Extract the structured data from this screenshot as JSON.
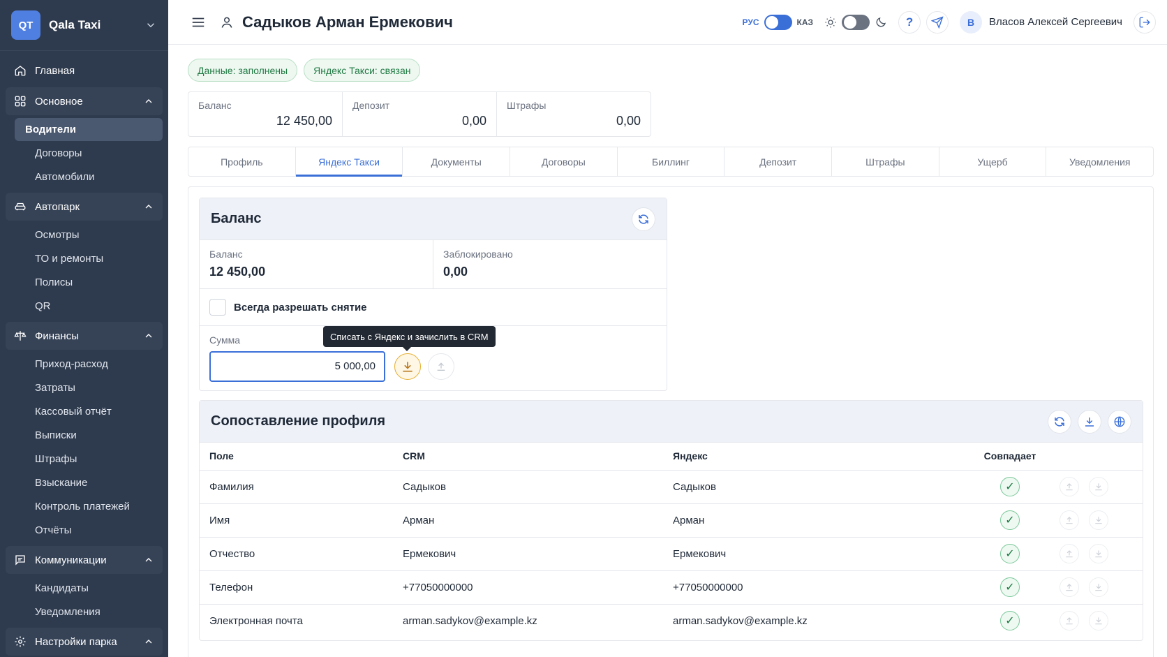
{
  "sidebar": {
    "logo": "QT",
    "brand": "Qala Taxi",
    "home": "Главная",
    "groups": [
      {
        "label": "Основное",
        "items": [
          "Водители",
          "Договоры",
          "Автомобили"
        ]
      },
      {
        "label": "Автопарк",
        "items": [
          "Осмотры",
          "ТО и ремонты",
          "Полисы",
          "QR"
        ]
      },
      {
        "label": "Финансы",
        "items": [
          "Приход-расход",
          "Затраты",
          "Кассовый отчёт",
          "Выписки",
          "Штрафы",
          "Взыскание",
          "Контроль платежей",
          "Отчёты"
        ]
      },
      {
        "label": "Коммуникации",
        "items": [
          "Кандидаты",
          "Уведомления"
        ]
      },
      {
        "label": "Настройки парка",
        "items": []
      }
    ],
    "active_item": "Водители"
  },
  "header": {
    "title": "Садыков Арман Ермекович",
    "lang_ru": "РУС",
    "lang_kz": "КАЗ",
    "help": "?",
    "avatar_letter": "В",
    "user_name": "Власов Алексей Сергеевич"
  },
  "badges": [
    "Данные: заполнены",
    "Яндекс Такси: связан"
  ],
  "stats": [
    {
      "label": "Баланс",
      "value": "12 450,00"
    },
    {
      "label": "Депозит",
      "value": "0,00"
    },
    {
      "label": "Штрафы",
      "value": "0,00"
    }
  ],
  "tabs": [
    "Профиль",
    "Яндекс Такси",
    "Документы",
    "Договоры",
    "Биллинг",
    "Депозит",
    "Штрафы",
    "Ущерб",
    "Уведомления"
  ],
  "active_tab": "Яндекс Такси",
  "balance_panel": {
    "title": "Баланс",
    "balance_label": "Баланс",
    "balance_value": "12 450,00",
    "blocked_label": "Заблокировано",
    "blocked_value": "0,00",
    "always_allow": "Всегда разрешать снятие",
    "always_allow_checked": false,
    "sum_label": "Сумма",
    "sum_value": "5 000,00",
    "tooltip": "Списать с Яндекс и зачислить в CRM"
  },
  "mapping_panel": {
    "title": "Сопоставление профиля",
    "columns": [
      "Поле",
      "CRM",
      "Яндекс",
      "Совпадает"
    ],
    "rows": [
      {
        "field": "Фамилия",
        "crm": "Садыков",
        "yandex": "Садыков",
        "match": "✓"
      },
      {
        "field": "Имя",
        "crm": "Арман",
        "yandex": "Арман",
        "match": "✓"
      },
      {
        "field": "Отчество",
        "crm": "Ермекович",
        "yandex": "Ермекович",
        "match": "✓"
      },
      {
        "field": "Телефон",
        "crm": "+77050000000",
        "yandex": "+77050000000",
        "match": "✓"
      },
      {
        "field": "Электронная почта",
        "crm": "arman.sadykov@example.kz",
        "yandex": "arman.sadykov@example.kz",
        "match": "✓"
      }
    ]
  },
  "colors": {
    "sidebar_bg": "#2e3a4d",
    "accent": "#3b6fd8",
    "success": "#217a44",
    "warning": "#e5ad2c"
  }
}
